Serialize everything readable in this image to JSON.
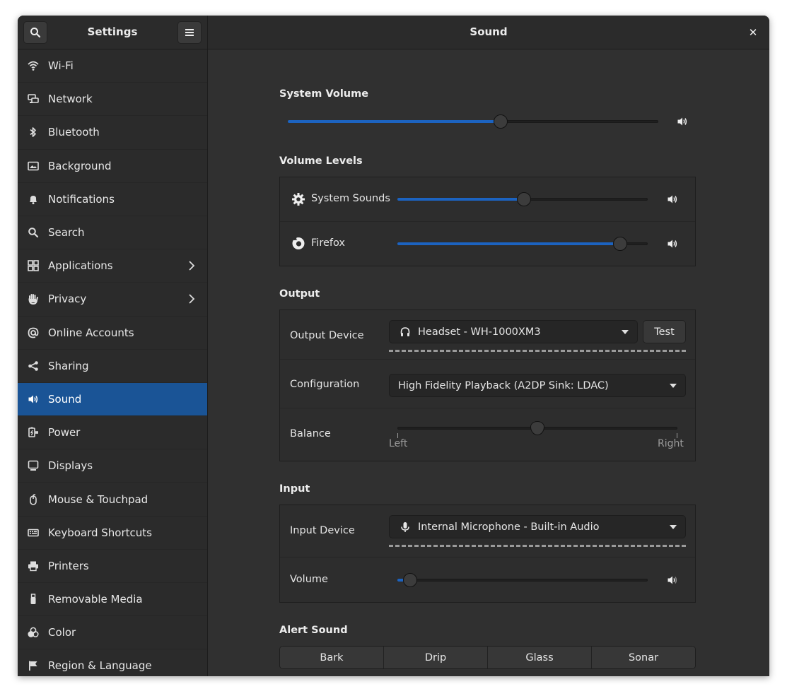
{
  "header": {
    "app_title": "Settings",
    "page_title": "Sound",
    "search_icon": "search-icon",
    "menu_icon": "hamburger-menu-icon",
    "close_icon": "close-icon",
    "close_glyph": "✕"
  },
  "sidebar": {
    "active_color": "#1a5496",
    "items": [
      {
        "label": "Wi-Fi",
        "icon": "wifi-icon"
      },
      {
        "label": "Network",
        "icon": "network-icon"
      },
      {
        "label": "Bluetooth",
        "icon": "bluetooth-icon"
      },
      {
        "label": "Background",
        "icon": "background-icon"
      },
      {
        "label": "Notifications",
        "icon": "bell-icon"
      },
      {
        "label": "Search",
        "icon": "search-icon"
      },
      {
        "label": "Applications",
        "icon": "applications-icon",
        "has_chevron": true
      },
      {
        "label": "Privacy",
        "icon": "hand-icon",
        "has_chevron": true
      },
      {
        "label": "Online Accounts",
        "icon": "at-sign-icon"
      },
      {
        "label": "Sharing",
        "icon": "share-icon"
      },
      {
        "label": "Sound",
        "icon": "speaker-icon",
        "active": true
      },
      {
        "label": "Power",
        "icon": "power-icon"
      },
      {
        "label": "Displays",
        "icon": "display-icon"
      },
      {
        "label": "Mouse & Touchpad",
        "icon": "mouse-icon"
      },
      {
        "label": "Keyboard Shortcuts",
        "icon": "keyboard-icon"
      },
      {
        "label": "Printers",
        "icon": "printer-icon"
      },
      {
        "label": "Removable Media",
        "icon": "usb-icon"
      },
      {
        "label": "Color",
        "icon": "color-icon"
      },
      {
        "label": "Region & Language",
        "icon": "flag-icon"
      }
    ]
  },
  "system_volume": {
    "title": "System Volume",
    "value": 0.575,
    "accent": "#1c63c0"
  },
  "volume_levels": {
    "title": "Volume Levels",
    "items": [
      {
        "label": "System Sounds",
        "icon": "gear-icon",
        "value": 0.505
      },
      {
        "label": "Firefox",
        "icon": "firefox-icon",
        "value": 0.89
      }
    ]
  },
  "output": {
    "title": "Output",
    "device_label": "Output Device",
    "device_value": "Headset - WH-1000XM3",
    "device_icon": "headphones-icon",
    "test_label": "Test",
    "config_label": "Configuration",
    "config_value": "High Fidelity Playback (A2DP Sink: LDAC)",
    "balance_label": "Balance",
    "balance_value": 0.5,
    "balance_left": "Left",
    "balance_right": "Right"
  },
  "input": {
    "title": "Input",
    "device_label": "Input Device",
    "device_value": "Internal Microphone - Built-in Audio",
    "device_icon": "microphone-icon",
    "volume_label": "Volume",
    "volume_value": 0.05
  },
  "alert_sound": {
    "title": "Alert Sound",
    "options": [
      "Bark",
      "Drip",
      "Glass",
      "Sonar"
    ]
  }
}
